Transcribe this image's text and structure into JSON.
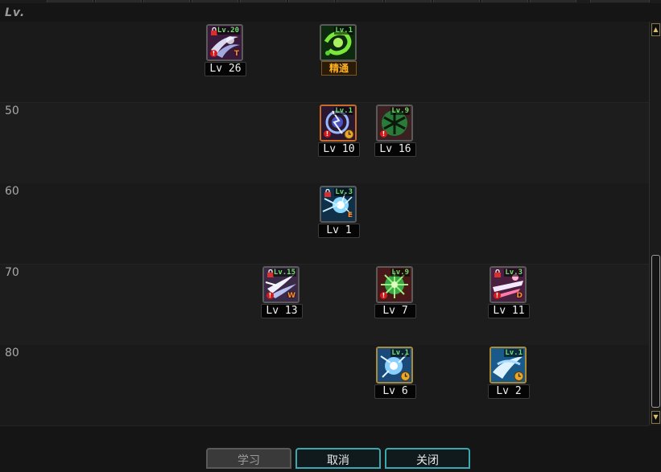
{
  "header": {
    "lv_label": "Lv."
  },
  "bands": [
    {
      "label": ""
    },
    {
      "label": "50"
    },
    {
      "label": "60"
    },
    {
      "label": "70"
    },
    {
      "label": "80"
    }
  ],
  "skills": [
    {
      "id": "skill-1",
      "lv_text": "Lv 26",
      "badge": "Lv.20",
      "locked": true,
      "key": "T",
      "art": "wind-icon"
    },
    {
      "id": "skill-2",
      "lv_text": "精通",
      "badge": "Lv.1",
      "locked": false,
      "key": "",
      "art": "green-vortex-icon"
    },
    {
      "id": "skill-3",
      "lv_text": "Lv 10",
      "badge": "Lv.1",
      "locked": false,
      "key": "",
      "art": "lightning-orb-icon"
    },
    {
      "id": "skill-4",
      "lv_text": "Lv 16",
      "badge": "Lv.9",
      "locked": false,
      "key": "",
      "art": "snowflake-icon"
    },
    {
      "id": "skill-5",
      "lv_text": "Lv 1",
      "badge": "Lv.3",
      "locked": true,
      "key": "E",
      "art": "ice-burst-icon"
    },
    {
      "id": "skill-6",
      "lv_text": "Lv 13",
      "badge": "Lv.15",
      "locked": true,
      "key": "W",
      "art": "wing-slash-icon"
    },
    {
      "id": "skill-7",
      "lv_text": "Lv 7",
      "badge": "Lv.9",
      "locked": false,
      "key": "",
      "art": "green-star-icon"
    },
    {
      "id": "skill-8",
      "lv_text": "Lv 11",
      "badge": "Lv.3",
      "locked": true,
      "key": "D",
      "art": "fire-slash-icon"
    },
    {
      "id": "skill-9",
      "lv_text": "Lv 6",
      "badge": "Lv.1",
      "locked": false,
      "key": "",
      "art": "blue-blast-icon"
    },
    {
      "id": "skill-10",
      "lv_text": "Lv 2",
      "badge": "Lv.1",
      "locked": false,
      "key": "",
      "art": "blue-wave-icon"
    }
  ],
  "buttons": {
    "learn": "学习",
    "cancel": "取消",
    "close": "关闭"
  },
  "colors": {
    "badge_green": "#6fe06a",
    "mastery_gold": "#ffb020",
    "active_button_border": "#3aa8b0"
  }
}
